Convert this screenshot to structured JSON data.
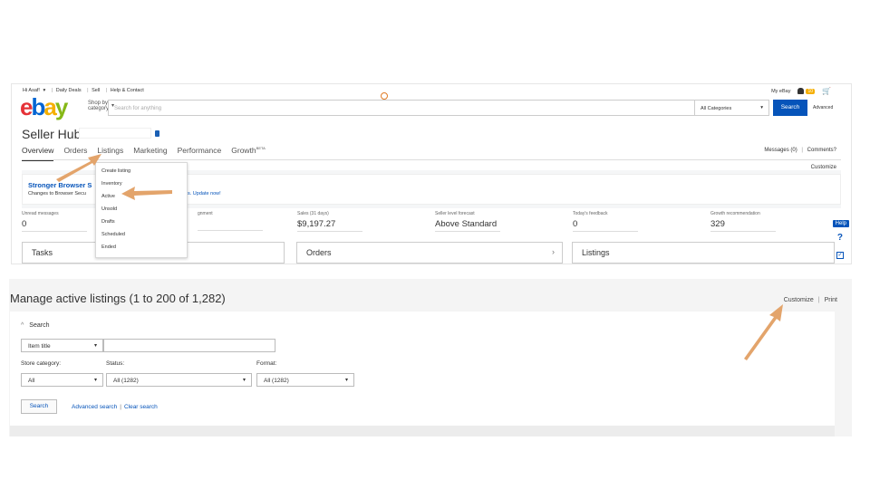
{
  "topbar": {
    "greeting": "Hi Asaf!",
    "greeting_caret": "▾",
    "links": [
      "Daily Deals",
      "Sell",
      "Help & Contact"
    ],
    "my_ebay": "My eBay",
    "notif_count": "10"
  },
  "header": {
    "logo": [
      "e",
      "b",
      "a",
      "y"
    ],
    "shop_by": "Shop by",
    "category": "category",
    "search_placeholder": "Search for anything",
    "categories": "All Categories",
    "search_button": "Search",
    "advanced": "Advanced"
  },
  "seller_hub": {
    "title": "Seller Hub",
    "tabs": [
      "Overview",
      "Orders",
      "Listings",
      "Marketing",
      "Performance",
      "Growth"
    ],
    "beta": "BETA",
    "messages": "Messages (0)",
    "comments": "Comments?",
    "customize": "Customize"
  },
  "banner": {
    "title": "Stronger Browser S",
    "subtitle": "Changes to Browser Secu",
    "update_suffix": "s. Update now!"
  },
  "stats": [
    {
      "label": "Unread messages",
      "value": "0"
    },
    {
      "label": "gnment",
      "value": ""
    },
    {
      "label": "Sales (31 days)",
      "value": "$9,197.27"
    },
    {
      "label": "Seller level forecast",
      "value": "Above Standard"
    },
    {
      "label": "Today's feedback",
      "value": "0"
    },
    {
      "label": "Growth recommendation",
      "value": "329"
    }
  ],
  "cards": [
    "Tasks",
    "Orders",
    "Listings"
  ],
  "listings_menu": [
    "Create listing",
    "Inventory",
    "Active",
    "Unsold",
    "Drafts",
    "Scheduled",
    "Ended"
  ],
  "help": {
    "label": "Help",
    "question": "?",
    "check": "✓"
  },
  "manage": {
    "title": "Manage active listings (1 to 200 of 1,282)",
    "customize": "Customize",
    "print": "Print",
    "search_toggle": "Search",
    "item_title": "Item title",
    "store_category_label": "Store category:",
    "store_category_value": "All",
    "status_label": "Status:",
    "status_value": "All (1282)",
    "format_label": "Format:",
    "format_value": "All (1282)",
    "search_button": "Search",
    "advanced_search": "Advanced search",
    "clear_search": "Clear search"
  },
  "colors": {
    "ebay_red": "#e53238",
    "ebay_blue": "#0064d2",
    "ebay_yellow": "#f5af02",
    "ebay_green": "#86b817",
    "link_blue": "#0654ba",
    "arrow": "#e3a46b"
  }
}
